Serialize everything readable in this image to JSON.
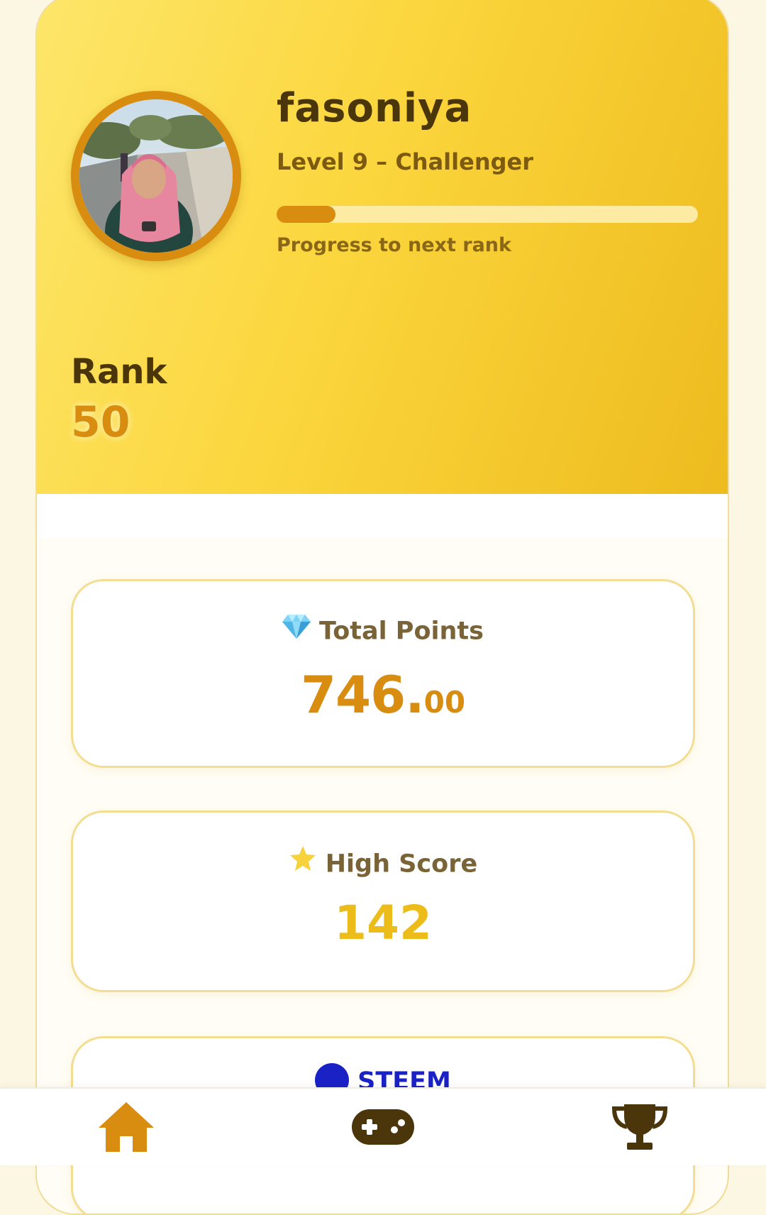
{
  "profile": {
    "username": "fasoniya",
    "level_text": "Level 9 – Challenger",
    "progress_fraction": 0.14,
    "progress_caption": "Progress to next rank",
    "rank_label": "Rank",
    "rank_value": "50"
  },
  "stats": {
    "total_points": {
      "icon": "diamond-icon",
      "label": "Total Points",
      "value_int": "746.",
      "value_dec": "00"
    },
    "high_score": {
      "icon": "star-icon",
      "label": "High Score",
      "value": "142"
    },
    "steem": {
      "icon": "steem-logo-icon",
      "label": "STEEM"
    }
  },
  "nav": {
    "items": [
      {
        "icon": "home-icon",
        "active": true
      },
      {
        "icon": "gamepad-icon",
        "active": false
      },
      {
        "icon": "trophy-icon",
        "active": false
      }
    ]
  },
  "colors": {
    "accent": "#d98d10",
    "hero_gradient_start": "#fde66a",
    "hero_gradient_end": "#edbb1e",
    "dark_text": "#4a360a",
    "score_gold": "#ecbc1a",
    "steem_blue": "#1a22c6"
  }
}
